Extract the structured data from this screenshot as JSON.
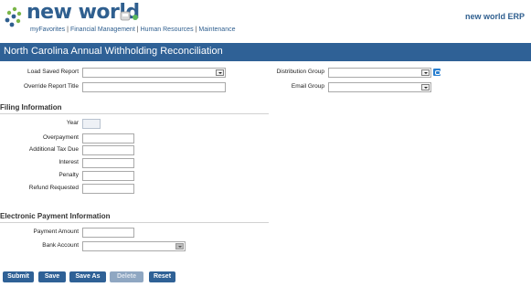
{
  "header": {
    "logo": "new world",
    "brand": "new world ERP",
    "nav": [
      "myFavorites",
      "Financial Management",
      "Human Resources",
      "Maintenance"
    ]
  },
  "page": {
    "title": "North Carolina Annual Withholding Reconciliation"
  },
  "report": {
    "load_saved_label": "Load Saved Report",
    "override_title_label": "Override Report Title",
    "distribution_label": "Distribution Group",
    "email_label": "Email Group"
  },
  "filing": {
    "heading": "Filing Information",
    "year_label": "Year",
    "overpayment_label": "Overpayment",
    "additional_tax_label": "Additional Tax Due",
    "interest_label": "Interest",
    "penalty_label": "Penalty",
    "refund_label": "Refund Requested"
  },
  "electronic": {
    "heading": "Electronic Payment Information",
    "amount_label": "Payment Amount",
    "bank_label": "Bank Account"
  },
  "buttons": {
    "submit": "Submit",
    "save": "Save",
    "save_as": "Save As",
    "delete": "Delete",
    "reset": "Reset"
  },
  "colors": {
    "accent": "#2f6196",
    "logo_blue": "#2f5f8f",
    "logo_green": "#7ab648"
  }
}
